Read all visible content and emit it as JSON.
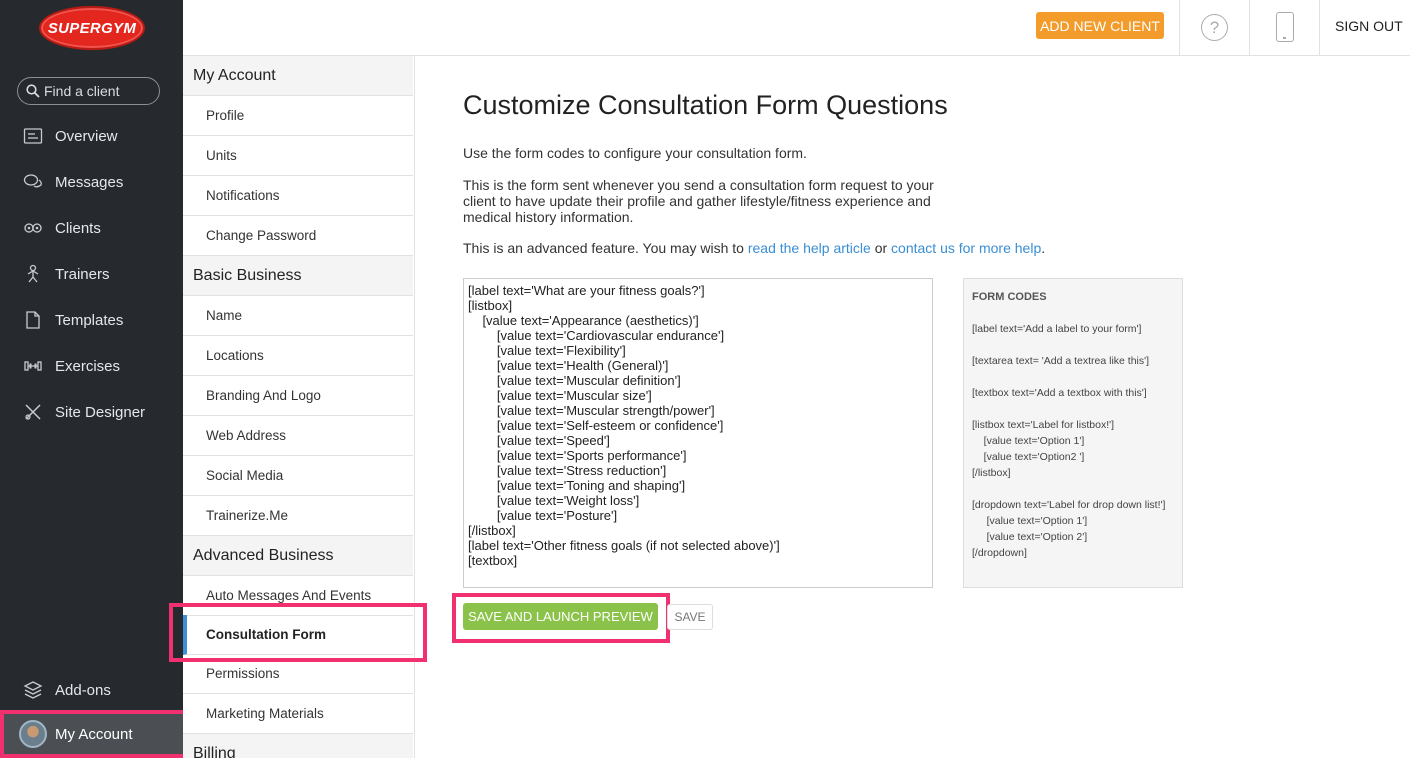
{
  "brand": {
    "logo_text": "SUPERGYM",
    "accent": "#e3261e"
  },
  "search": {
    "placeholder": "Find a client"
  },
  "sidebar": {
    "items": [
      {
        "label": "Overview",
        "icon": "overview-icon"
      },
      {
        "label": "Messages",
        "icon": "messages-icon"
      },
      {
        "label": "Clients",
        "icon": "clients-icon"
      },
      {
        "label": "Trainers",
        "icon": "trainers-icon"
      },
      {
        "label": "Templates",
        "icon": "templates-icon"
      },
      {
        "label": "Exercises",
        "icon": "exercises-icon"
      },
      {
        "label": "Site Designer",
        "icon": "site-designer-icon"
      }
    ],
    "addons": "Add-ons",
    "my_account": "My Account"
  },
  "topbar": {
    "add_client": "ADD NEW CLIENT",
    "help": "?",
    "sign_out": "SIGN OUT"
  },
  "settings_nav": {
    "sections": [
      {
        "header": "My Account",
        "items": [
          "Profile",
          "Units",
          "Notifications",
          "Change Password"
        ]
      },
      {
        "header": "Basic Business",
        "items": [
          "Name",
          "Locations",
          "Branding And Logo",
          "Web Address",
          "Social Media",
          "Trainerize.Me"
        ]
      },
      {
        "header": "Advanced Business",
        "items": [
          "Auto Messages And Events",
          "Consultation Form",
          "Permissions",
          "Marketing Materials"
        ]
      },
      {
        "header": "Billing",
        "items": []
      }
    ],
    "active": "Consultation Form"
  },
  "main": {
    "title": "Customize Consultation Form Questions",
    "intro": "Use the form codes to configure your consultation form.",
    "description": "This is the form sent whenever you send a consultation form request to your client to have update their profile and gather lifestyle/fitness experience and medical history information.",
    "advanced_prefix": "This is an advanced feature. You may wish to ",
    "help_link": "read the help article",
    "or": " or ",
    "contact_link": "contact us for more help",
    "period": ".",
    "form_code": "[label text='What are your fitness goals?']\n[listbox]\n    [value text='Appearance (aesthetics)']\n        [value text='Cardiovascular endurance']\n        [value text='Flexibility']\n        [value text='Health (General)']\n        [value text='Muscular definition']\n        [value text='Muscular size']\n        [value text='Muscular strength/power']\n        [value text='Self-esteem or confidence']\n        [value text='Speed']\n        [value text='Sports performance']\n        [value text='Stress reduction']\n        [value text='Toning and shaping']\n        [value text='Weight loss']\n        [value text='Posture']\n[/listbox]\n[label text='Other fitness goals (if not selected above)']\n[textbox]",
    "codes": {
      "title": "FORM CODES",
      "blocks": [
        "[label text='Add a label to your form']",
        "[textarea text= 'Add a textrea like this']",
        "[textbox text='Add a textbox with this']",
        "[listbox text='Label for listbox!']\n    [value text='Option 1']\n    [value text='Option2 ']\n[/listbox]",
        "[dropdown text='Label for drop down list!']\n     [value text='Option 1']\n     [value text='Option 2']\n[/dropdown]"
      ]
    },
    "save_preview": "SAVE AND LAUNCH PREVIEW",
    "save": "SAVE"
  }
}
